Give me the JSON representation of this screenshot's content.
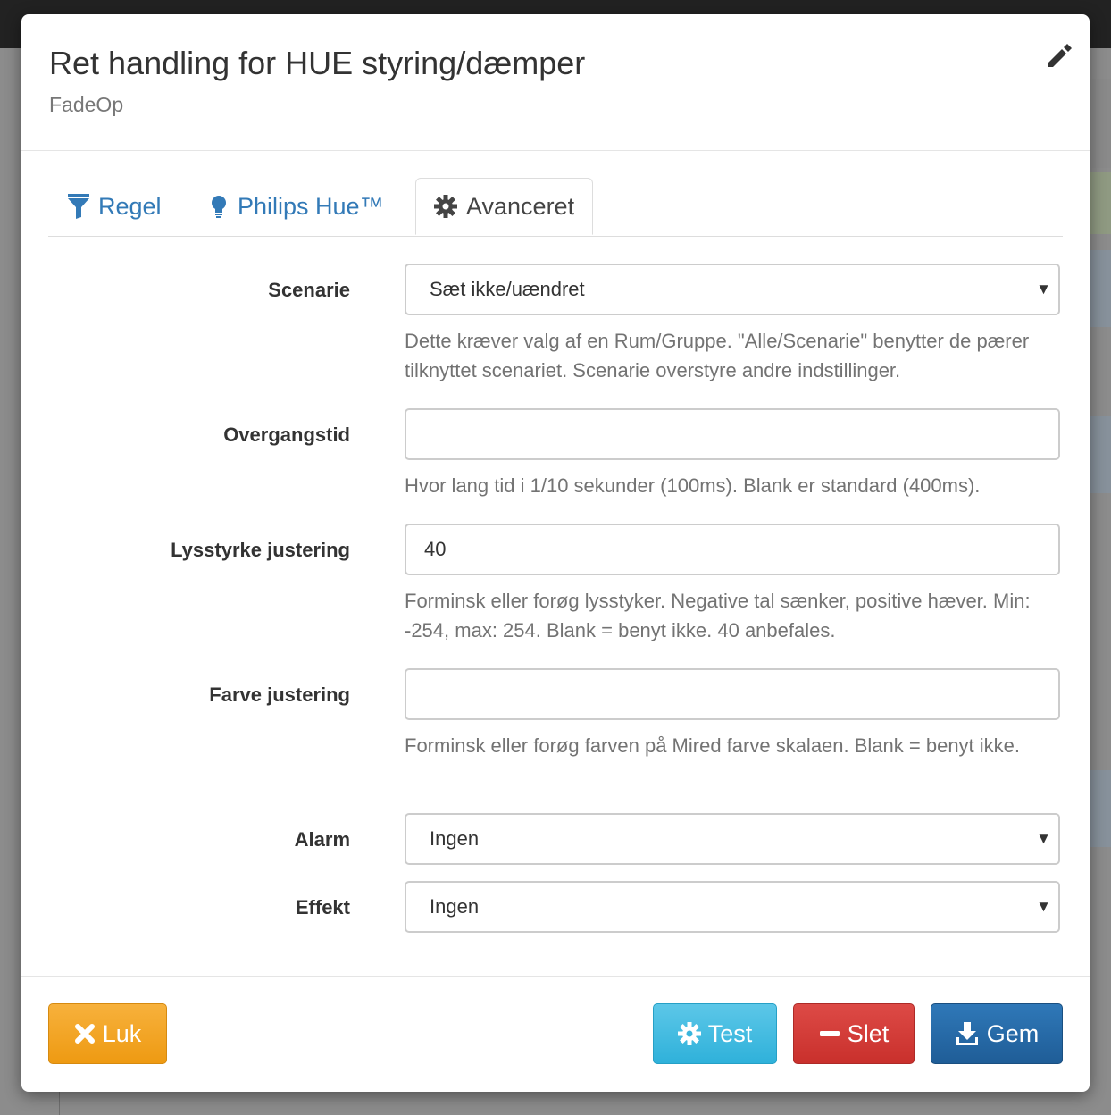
{
  "modal": {
    "title": "Ret handling for HUE styring/dæmper",
    "subtitle": "FadeOp"
  },
  "tabs": [
    {
      "label": "Regel",
      "icon": "filter-icon",
      "active": false
    },
    {
      "label": "Philips Hue™",
      "icon": "lightbulb-icon",
      "active": false
    },
    {
      "label": "Avanceret",
      "icon": "gear-icon",
      "active": true
    }
  ],
  "fields": {
    "scenarie": {
      "label": "Scenarie",
      "value": "Sæt ikke/uændret",
      "help": "Dette kræver valg af en Rum/Gruppe. \"Alle/Scenarie\" benytter de pærer tilknyttet scenariet. Scenarie overstyre andre indstillinger."
    },
    "overgangstid": {
      "label": "Overgangstid",
      "value": "",
      "help": "Hvor lang tid i 1/10 sekunder (100ms). Blank er standard (400ms)."
    },
    "lysstyrke": {
      "label": "Lysstyrke justering",
      "value": "40",
      "help": "Forminsk eller forøg lysstyker. Negative tal sænker, positive hæver. Min: -254, max: 254. Blank = benyt ikke. 40 anbefales."
    },
    "farve": {
      "label": "Farve justering",
      "value": "",
      "help": "Forminsk eller forøg farven på Mired farve skalaen. Blank = benyt ikke."
    },
    "alarm": {
      "label": "Alarm",
      "value": "Ingen"
    },
    "effekt": {
      "label": "Effekt",
      "value": "Ingen"
    }
  },
  "footer": {
    "close_label": "Luk",
    "test_label": "Test",
    "delete_label": "Slet",
    "save_label": "Gem"
  },
  "colors": {
    "link": "#337ab7",
    "warning": "#f0a020",
    "info": "#34b3da",
    "danger": "#cf3430",
    "primary": "#25679f"
  }
}
